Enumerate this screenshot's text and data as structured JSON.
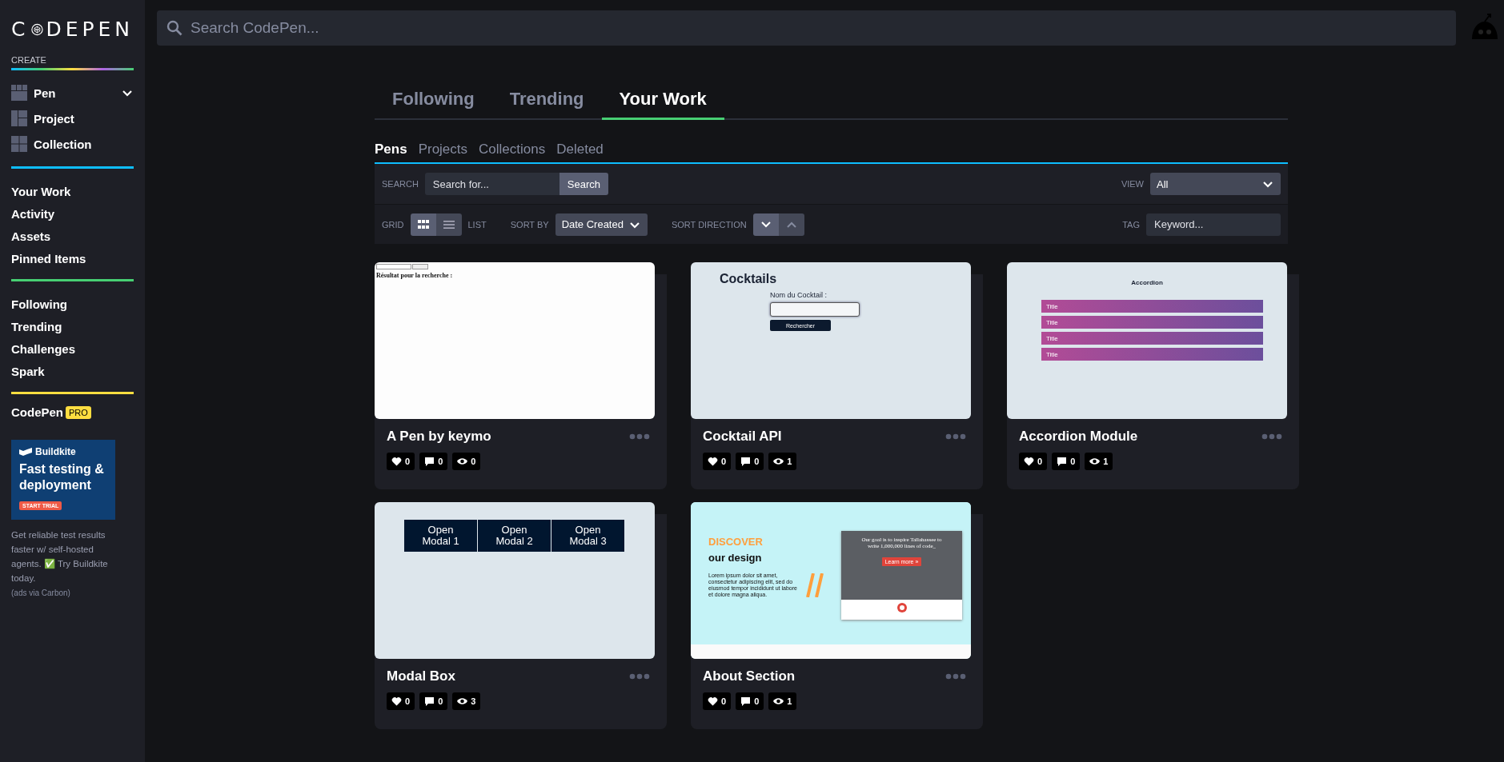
{
  "sidebar": {
    "logo": {
      "before": "C",
      "after": "DEPEN"
    },
    "create_label": "CREATE",
    "create_items": [
      {
        "label": "Pen",
        "kind": "pen",
        "dropdown": true
      },
      {
        "label": "Project",
        "kind": "project",
        "dropdown": false
      },
      {
        "label": "Collection",
        "kind": "collection",
        "dropdown": false
      }
    ],
    "nav_groups": [
      {
        "items": [
          "Your Work",
          "Activity",
          "Assets",
          "Pinned Items"
        ]
      },
      {
        "items": [
          "Following",
          "Trending",
          "Challenges",
          "Spark"
        ]
      }
    ],
    "pro_link": {
      "label": "CodePen",
      "badge": "PRO"
    },
    "ad": {
      "brand": "Buildkite",
      "headline": "Fast testing & deployment",
      "cta": "START TRIAL",
      "text": "Get reliable test results faster w/ self-hosted agents. ✅ Try Buildkite today.",
      "credit": "(ads via Carbon)"
    }
  },
  "top_bar": {
    "search": {
      "placeholder": "Search CodePen..."
    }
  },
  "main_tabs": [
    {
      "label": "Following",
      "selected": false
    },
    {
      "label": "Trending",
      "selected": false
    },
    {
      "label": "Your Work",
      "selected": true
    }
  ],
  "sub_tabs": [
    {
      "label": "Pens",
      "selected": true
    },
    {
      "label": "Projects",
      "selected": false
    },
    {
      "label": "Collections",
      "selected": false
    },
    {
      "label": "Deleted",
      "selected": false
    }
  ],
  "filters": {
    "search_label": "SEARCH",
    "search_placeholder": "Search for...",
    "search_button": "Search",
    "view_label": "VIEW",
    "view_value": "All",
    "grid_label": "GRID",
    "list_label": "LIST",
    "layout": [
      {
        "kind": "grid",
        "selected": true
      },
      {
        "kind": "list",
        "selected": false
      }
    ],
    "sort_by_label": "SORT BY",
    "sort_by_value": "Date Created",
    "sort_direction_label": "SORT DIRECTION",
    "sort_direction": [
      {
        "kind": "descending",
        "selected": true
      },
      {
        "kind": "ascending",
        "selected": false
      }
    ],
    "tag_label": "TAG",
    "tag_placeholder": "Keyword..."
  },
  "pens": [
    {
      "title": "A Pen by keymo",
      "likes": "0",
      "comments": "0",
      "views": "0",
      "preview": {
        "kind": "search_page",
        "heading": "Résultat pour la recherche :"
      }
    },
    {
      "title": "Cocktail API",
      "likes": "0",
      "comments": "0",
      "views": "1",
      "preview": {
        "kind": "search_form",
        "heading": "Cocktails",
        "label": "Nom du Cocktail :",
        "button": "Rechercher"
      }
    },
    {
      "title": "Accordion Module",
      "likes": "0",
      "comments": "0",
      "views": "1",
      "preview": {
        "kind": "accordion",
        "heading": "Accordion",
        "items": [
          "Title",
          "Title",
          "Title",
          "Title"
        ]
      }
    },
    {
      "title": "Modal Box",
      "likes": "0",
      "comments": "0",
      "views": "3",
      "preview": {
        "kind": "buttons",
        "buttons": [
          "Open Modal 1",
          "Open Modal 2",
          "Open Modal 3"
        ]
      }
    },
    {
      "title": "About Section",
      "likes": "0",
      "comments": "0",
      "views": "1",
      "preview": {
        "kind": "landing",
        "highlight": "DISCOVER",
        "heading_rest": "our design",
        "body": "Lorem ipsum dolor sit amet, consectetur adipiscing elit, sed do eiusmod tempor incididunt ut labore et dolore magna aliqua.",
        "shot_heading": "Our goal is to inspire Tallahassee to write 1,000,000 lines of code_",
        "shot_button": "Learn more »"
      }
    }
  ]
}
